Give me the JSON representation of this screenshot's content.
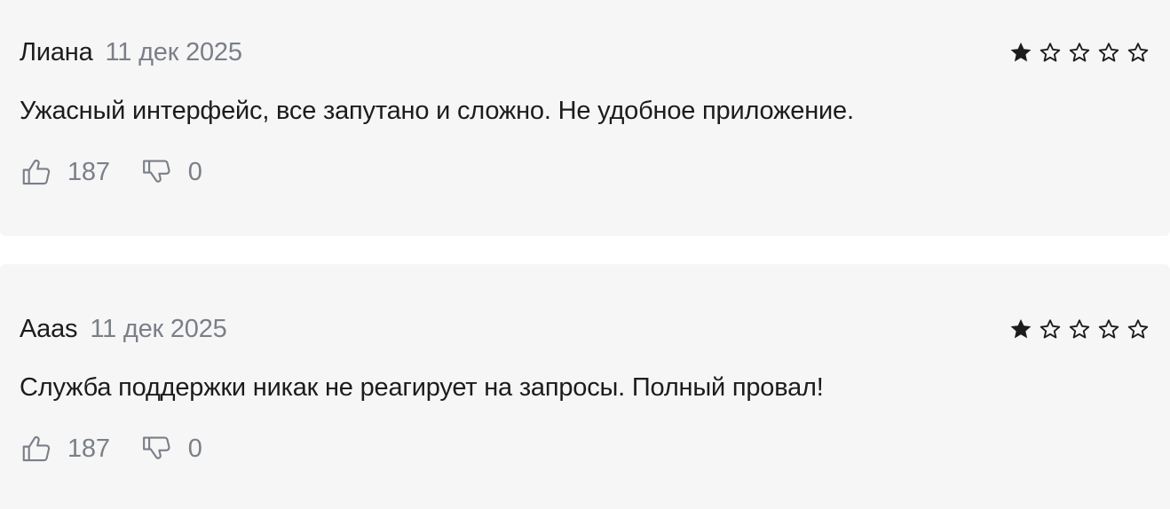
{
  "reviews": [
    {
      "author": "Лиана",
      "date": "11 дек 2025",
      "rating": 1,
      "rating_max": 5,
      "text": "Ужасный интерфейс, все запутано и сложно. Не удобное приложение.",
      "likes": "187",
      "dislikes": "0"
    },
    {
      "author": "Aaas",
      "date": "11 дек 2025",
      "rating": 1,
      "rating_max": 5,
      "text": "Служба поддержки никак не реагирует на запросы. Полный провал!",
      "likes": "187",
      "dislikes": "0"
    }
  ],
  "icons": {
    "like": "thumbs-up-icon",
    "dislike": "thumbs-down-icon",
    "star_filled": "star-filled-icon",
    "star_empty": "star-outline-icon"
  },
  "colors": {
    "card_background": "#f6f6f6",
    "text_primary": "#1c1c1e",
    "text_secondary": "#7a7f88",
    "star": "#1c1c1e"
  }
}
